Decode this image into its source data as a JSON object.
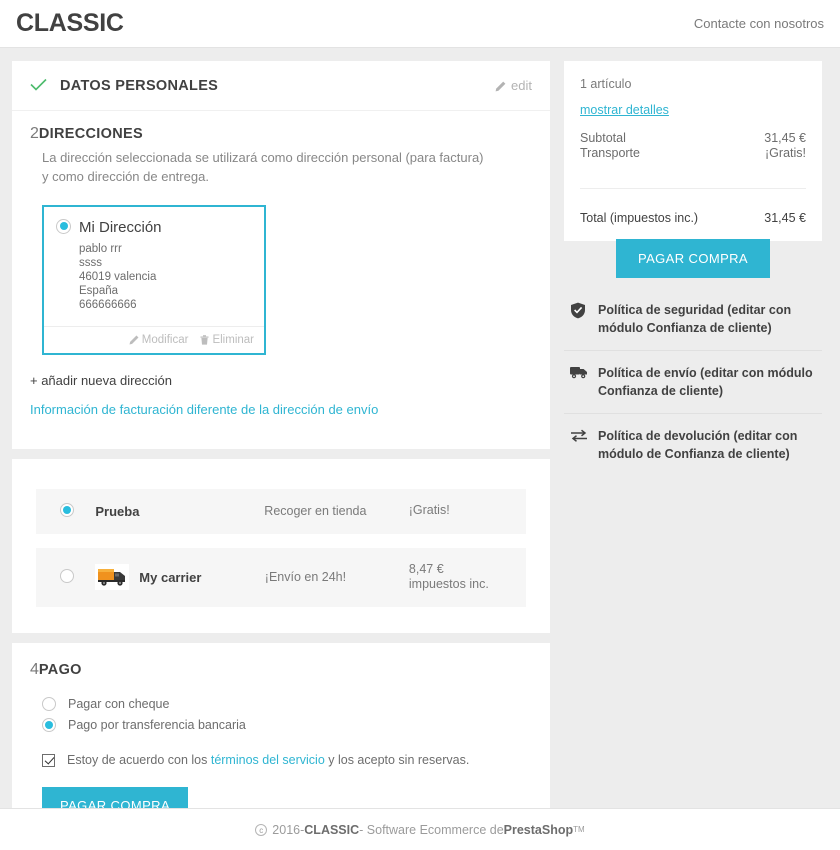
{
  "header": {
    "logo": "CLASSIC",
    "contact_label": "Contacte con nosotros"
  },
  "checkout": {
    "step1": {
      "number_icon": "check-icon",
      "title": "DATOS PERSONALES",
      "edit_label": "edit"
    },
    "step2": {
      "number": "2",
      "title": "DIRECCIONES",
      "description": "La dirección seleccionada se utilizará como dirección personal (para factura) y como dirección de entrega.",
      "address": {
        "selected": true,
        "name": "Mi Dirección",
        "lines": [
          "pablo rrr",
          "ssss",
          "46019 valencia",
          "España",
          "666666666"
        ],
        "edit_label": "Modificar",
        "delete_label": "Eliminar"
      },
      "add_address_label": "+ añadir nueva dirección",
      "alt_billing_label": "Información de facturación diferente de la dirección de envío"
    },
    "step3": {
      "carriers": [
        {
          "name": "Prueba",
          "delay": "Recoger en tienda",
          "price": "¡Gratis!",
          "selected": true,
          "has_logo": false
        },
        {
          "name": "My carrier",
          "delay": "¡Envío en 24h!",
          "price": "8,47 € impuestos inc.",
          "selected": false,
          "has_logo": true
        }
      ]
    },
    "step4": {
      "number": "4",
      "title": "PAGO",
      "options": [
        {
          "label": "Pagar con cheque",
          "selected": false
        },
        {
          "label": "Pago por transferencia bancaria",
          "selected": true
        }
      ],
      "terms": {
        "checked": true,
        "prefix": "Estoy de acuerdo con los ",
        "link": "términos del servicio",
        "suffix": " y los acepto sin reservas."
      },
      "submit_label": "PAGAR COMPRA"
    }
  },
  "summary": {
    "items_count": "1 artículo",
    "show_details_label": "mostrar detalles",
    "rows": [
      {
        "label": "Subtotal",
        "value": "31,45 €"
      },
      {
        "label": "Transporte",
        "value": "¡Gratis!"
      }
    ],
    "total_label": "Total (impuestos inc.)",
    "total_value": "31,45 €",
    "submit_label": "PAGAR COMPRA",
    "policies": [
      {
        "icon": "shield-icon",
        "text": "Política de seguridad (editar con módulo Confianza de cliente)"
      },
      {
        "icon": "truck-icon",
        "text": "Política de envío (editar con módulo Confianza de cliente)"
      },
      {
        "icon": "exchange-icon",
        "text": "Política de devolución (editar con módulo de Confianza de cliente)"
      }
    ]
  },
  "footer": {
    "year": "2016",
    "shop": "CLASSIC",
    "middle": " - Software Ecommerce de ",
    "brand": "PrestaShop",
    "tm": "TM",
    "separator": " - "
  },
  "colors": {
    "accent": "#2fb5d2",
    "radio_fill": "#29bdde",
    "check_green": "#4cbb6c",
    "page_bg": "#ededed",
    "text_dark": "#414141"
  }
}
